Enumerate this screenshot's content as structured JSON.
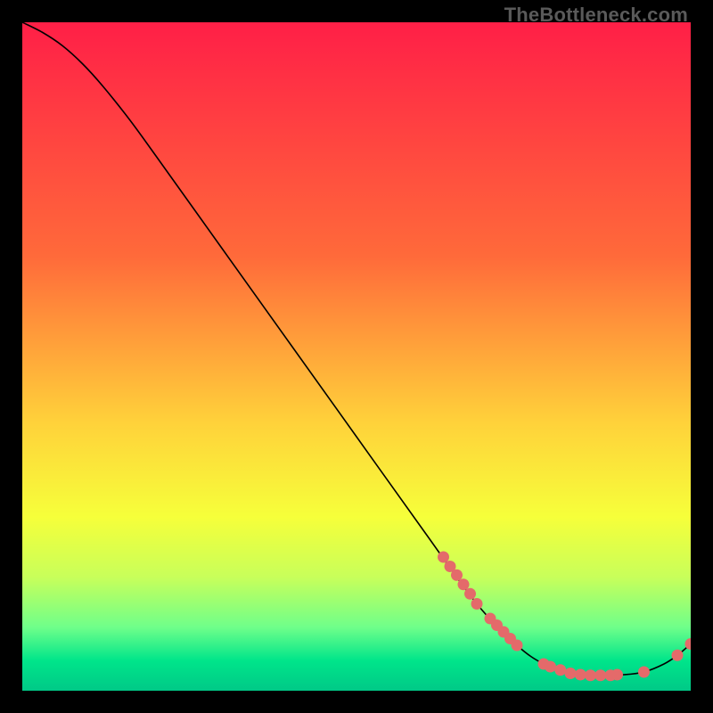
{
  "watermark": "TheBottleneck.com",
  "chart_data": {
    "type": "line",
    "title": "",
    "xlabel": "",
    "ylabel": "",
    "xlim": [
      0,
      100
    ],
    "ylim": [
      0,
      100
    ],
    "background_gradient": {
      "stops": [
        {
          "offset": 0.0,
          "color": "#ff1f47"
        },
        {
          "offset": 0.35,
          "color": "#ff6a3a"
        },
        {
          "offset": 0.6,
          "color": "#ffd23a"
        },
        {
          "offset": 0.74,
          "color": "#f6ff3a"
        },
        {
          "offset": 0.83,
          "color": "#c8ff5a"
        },
        {
          "offset": 0.905,
          "color": "#6fff8a"
        },
        {
          "offset": 0.955,
          "color": "#00e58a"
        },
        {
          "offset": 1.0,
          "color": "#00c987"
        }
      ]
    },
    "series": [
      {
        "name": "bottleneck-curve",
        "color": "#000000",
        "width": 1.6,
        "points": [
          {
            "x": 0.0,
            "y": 100.0
          },
          {
            "x": 3.0,
            "y": 98.5
          },
          {
            "x": 6.0,
            "y": 96.5
          },
          {
            "x": 9.0,
            "y": 93.8
          },
          {
            "x": 12.0,
            "y": 90.5
          },
          {
            "x": 16.0,
            "y": 85.5
          },
          {
            "x": 20.0,
            "y": 80.0
          },
          {
            "x": 30.0,
            "y": 66.0
          },
          {
            "x": 40.0,
            "y": 52.0
          },
          {
            "x": 50.0,
            "y": 38.0
          },
          {
            "x": 60.0,
            "y": 24.0
          },
          {
            "x": 68.0,
            "y": 13.0
          },
          {
            "x": 74.0,
            "y": 6.8
          },
          {
            "x": 78.0,
            "y": 4.0
          },
          {
            "x": 82.0,
            "y": 2.6
          },
          {
            "x": 86.0,
            "y": 2.3
          },
          {
            "x": 90.0,
            "y": 2.4
          },
          {
            "x": 93.0,
            "y": 2.8
          },
          {
            "x": 96.0,
            "y": 4.0
          },
          {
            "x": 98.0,
            "y": 5.3
          },
          {
            "x": 100.0,
            "y": 7.0
          }
        ]
      }
    ],
    "markers": {
      "color": "#e46a6a",
      "radius": 6.5,
      "points": [
        {
          "x": 63.0,
          "y": 20.0
        },
        {
          "x": 64.0,
          "y": 18.6
        },
        {
          "x": 65.0,
          "y": 17.3
        },
        {
          "x": 66.0,
          "y": 15.9
        },
        {
          "x": 67.0,
          "y": 14.5
        },
        {
          "x": 68.0,
          "y": 13.0
        },
        {
          "x": 70.0,
          "y": 10.8
        },
        {
          "x": 71.0,
          "y": 9.8
        },
        {
          "x": 72.0,
          "y": 8.8
        },
        {
          "x": 73.0,
          "y": 7.8
        },
        {
          "x": 74.0,
          "y": 6.8
        },
        {
          "x": 78.0,
          "y": 4.0
        },
        {
          "x": 79.0,
          "y": 3.6
        },
        {
          "x": 80.5,
          "y": 3.1
        },
        {
          "x": 82.0,
          "y": 2.6
        },
        {
          "x": 83.5,
          "y": 2.4
        },
        {
          "x": 85.0,
          "y": 2.3
        },
        {
          "x": 86.5,
          "y": 2.3
        },
        {
          "x": 88.0,
          "y": 2.3
        },
        {
          "x": 89.0,
          "y": 2.4
        },
        {
          "x": 93.0,
          "y": 2.8
        },
        {
          "x": 98.0,
          "y": 5.3
        },
        {
          "x": 100.0,
          "y": 7.0
        }
      ]
    }
  }
}
